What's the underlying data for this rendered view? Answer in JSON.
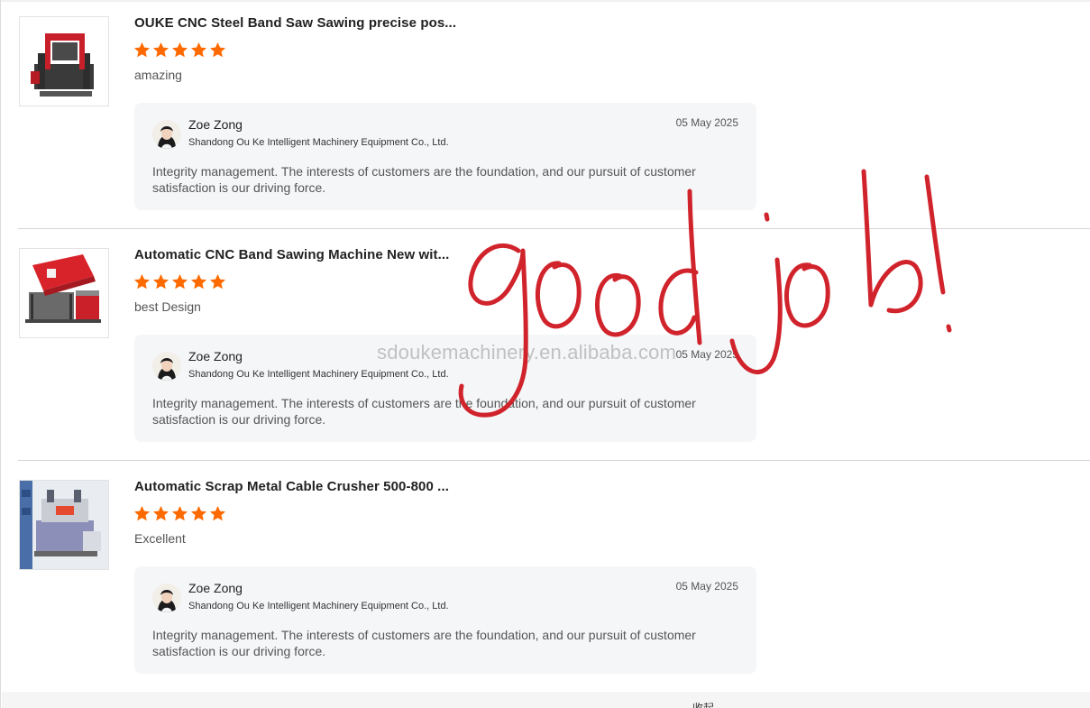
{
  "reviews": [
    {
      "product_title": "OUKE CNC Steel Band Saw Sawing precise pos...",
      "rating": 5,
      "comment": "amazing",
      "reply": {
        "name": "Zoe Zong",
        "company": "Shandong Ou Ke Intelligent Machinery Equipment Co., Ltd.",
        "date": "05 May 2025",
        "text": "Integrity management. The interests of customers are the foundation, and our pursuit of customer satisfaction is our driving force."
      }
    },
    {
      "product_title": "Automatic CNC Band Sawing Machine New wit...",
      "rating": 5,
      "comment": "best Design",
      "reply": {
        "name": "Zoe Zong",
        "company": "Shandong Ou Ke Intelligent Machinery Equipment Co., Ltd.",
        "date": "05 May 2025",
        "text": "Integrity management. The interests of customers are the foundation, and our pursuit of customer satisfaction is our driving force."
      }
    },
    {
      "product_title": "Automatic Scrap Metal Cable Crusher 500-800 ...",
      "rating": 5,
      "comment": "Excellent",
      "reply": {
        "name": "Zoe Zong",
        "company": "Shandong Ou Ke Intelligent Machinery Equipment Co., Ltd.",
        "date": "05 May 2025",
        "text": "Integrity management. The interests of customers are the foundation, and our pursuit of customer satisfaction is our driving force."
      }
    }
  ],
  "overlay": {
    "watermark": "sdoukemachinery.en.alibaba.com",
    "handwriting": "good job!"
  },
  "footer": {
    "collapse_label": "收起",
    "collapse_icon": "chevron-up-icon"
  },
  "colors": {
    "star": "#ff6a00",
    "handwriting": "#d0232b",
    "reply_bg": "#f5f6f8"
  }
}
